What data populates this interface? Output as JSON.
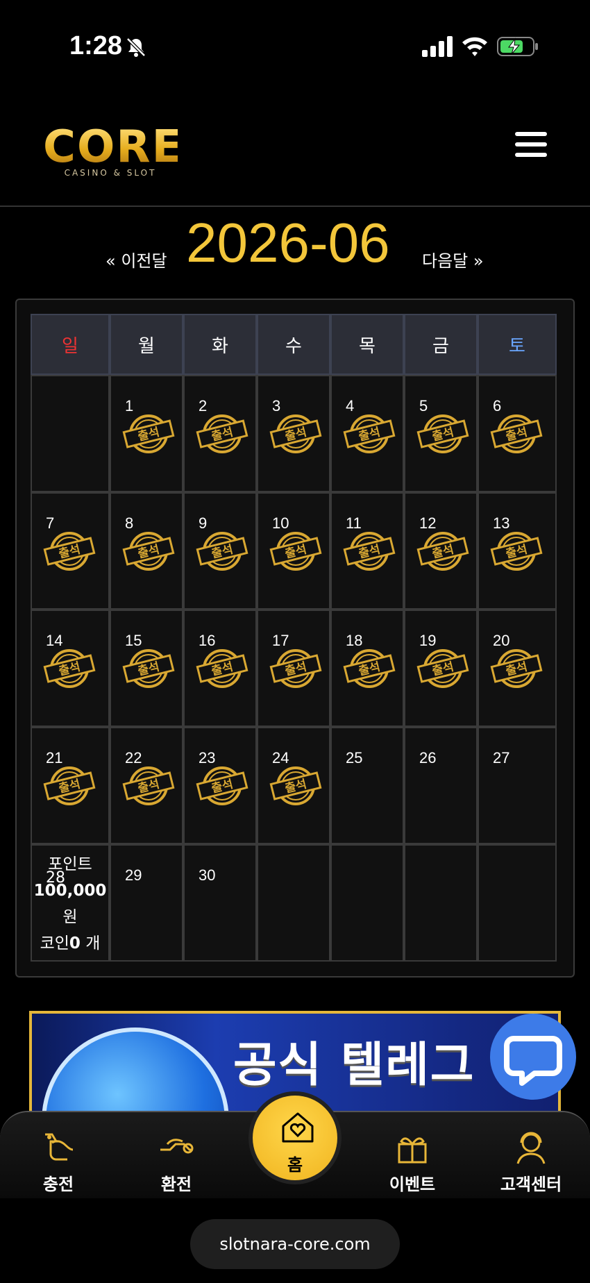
{
  "status_bar": {
    "time": "1:28"
  },
  "header": {
    "logo_text": "CORE",
    "logo_subtitle": "CASINO & SLOT"
  },
  "month_nav": {
    "prev_label": "« 이전달",
    "title": "2026-06",
    "next_label": "다음달 »"
  },
  "calendar": {
    "weekdays": [
      "일",
      "월",
      "화",
      "수",
      "목",
      "금",
      "토"
    ],
    "stamp_text": "출석",
    "weeks": [
      [
        "",
        "1",
        "2",
        "3",
        "4",
        "5",
        "6"
      ],
      [
        "7",
        "8",
        "9",
        "10",
        "11",
        "12",
        "13"
      ],
      [
        "14",
        "15",
        "16",
        "17",
        "18",
        "19",
        "20"
      ],
      [
        "21",
        "22",
        "23",
        "24",
        "25",
        "26",
        "27"
      ],
      [
        "28",
        "29",
        "30",
        "",
        "",
        "",
        ""
      ]
    ],
    "attended_days": [
      1,
      2,
      3,
      4,
      5,
      6,
      7,
      8,
      9,
      10,
      11,
      12,
      13,
      14,
      15,
      16,
      17,
      18,
      19,
      20,
      21,
      22,
      23,
      24
    ],
    "points_label": "포인트",
    "points_value": "100,000",
    "points_unit": "원",
    "coin_label": "코인",
    "coin_value": "0",
    "coin_unit": "개"
  },
  "banner": {
    "text": "공식 텔레그"
  },
  "bottom_nav": {
    "charge": "충전",
    "exchange": "환전",
    "home": "홈",
    "event": "이벤트",
    "support": "고객센터"
  },
  "url": "slotnara-core.com",
  "colors": {
    "accent": "#f3c63a",
    "sunday": "#e33333",
    "saturday": "#6aa6ff",
    "chat": "#3d7be8"
  }
}
